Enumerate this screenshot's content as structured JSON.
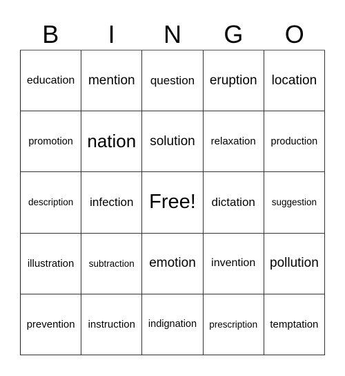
{
  "header": {
    "letters": [
      "B",
      "I",
      "N",
      "G",
      "O"
    ]
  },
  "grid": {
    "rows": [
      [
        "education",
        "mention",
        "question",
        "eruption",
        "location"
      ],
      [
        "promotion",
        "nation",
        "solution",
        "relaxation",
        "production"
      ],
      [
        "description",
        "infection",
        "Free!",
        "dictation",
        "suggestion"
      ],
      [
        "illustration",
        "subtraction",
        "emotion",
        "invention",
        "pollution"
      ],
      [
        "prevention",
        "instruction",
        "indignation",
        "prescription",
        "temptation"
      ]
    ]
  }
}
